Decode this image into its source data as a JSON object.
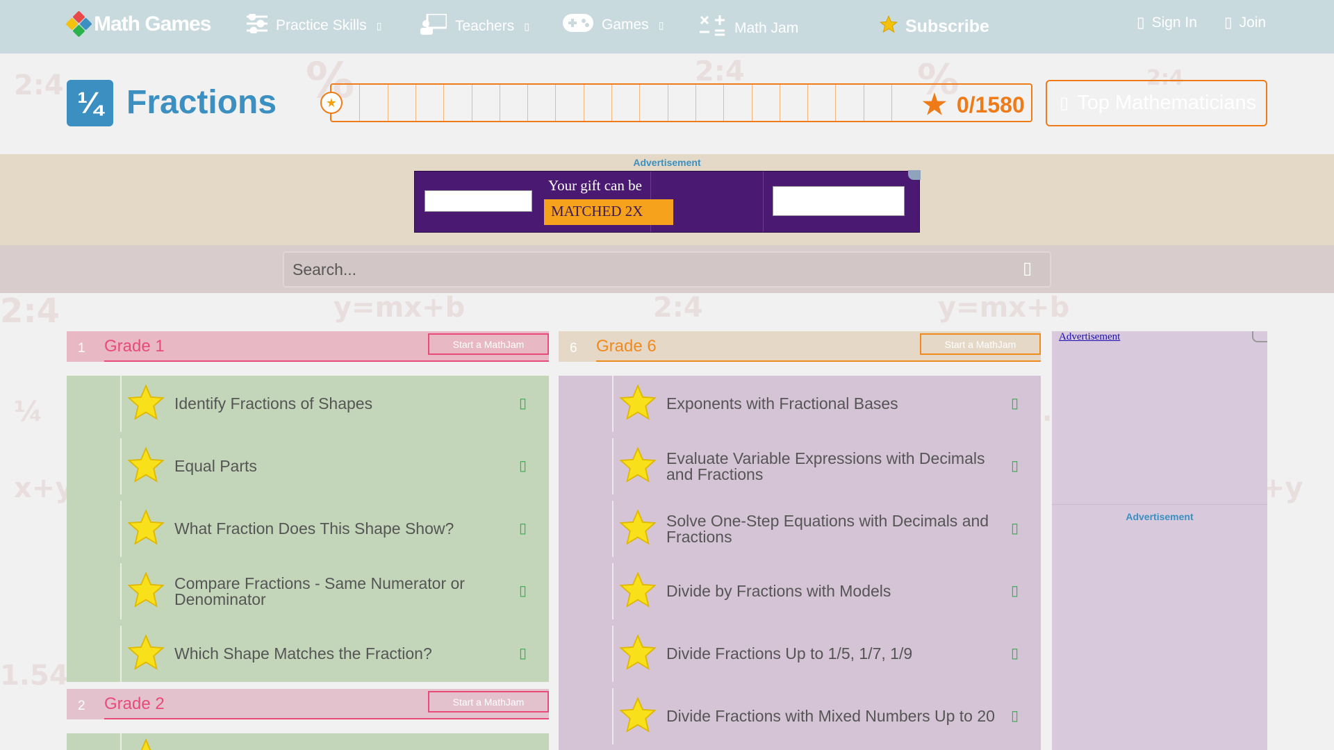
{
  "nav": {
    "logo_text": "Math Games",
    "practice_skills": "Practice Skills",
    "teachers": "Teachers",
    "games": "Games",
    "math_jam": "Math Jam",
    "subscribe": "Subscribe",
    "sign_in": "Sign In",
    "join": "Join"
  },
  "topic": {
    "icon_text": "¼",
    "title": "Fractions",
    "progress_score": "0/1580",
    "top_mathematicians": "Top Mathematicians"
  },
  "ad_top": {
    "label": "Advertisement",
    "line1": "Your gift can be",
    "line2": "MATCHED 2X"
  },
  "search": {
    "placeholder": "Search..."
  },
  "grades": [
    {
      "num": "1",
      "title": "Grade 1",
      "mathjam_label": "Start a MathJam",
      "skills": [
        "Identify Fractions of Shapes",
        "Equal Parts",
        "What Fraction Does This Shape Show?",
        "Compare Fractions - Same Numerator or Denominator",
        "Which Shape Matches the Fraction?"
      ]
    },
    {
      "num": "6",
      "title": "Grade 6",
      "mathjam_label": "Start a MathJam",
      "skills": [
        "Exponents with Fractional Bases",
        "Evaluate Variable Expressions with Decimals and Fractions",
        "Solve One-Step Equations with Decimals and Fractions",
        "Divide by Fractions with Models",
        "Divide Fractions Up to 1/5, 1/7, 1/9",
        "Divide Fractions with Mixed Numbers Up to 20"
      ]
    },
    {
      "num": "2",
      "title": "Grade 2",
      "mathjam_label": "Start a MathJam",
      "skills": []
    }
  ],
  "right_ad": {
    "link_text": "Advertisement",
    "label": "Advertisement"
  },
  "colors": {
    "nav_bg": "#c9dadf",
    "brand_blue": "#3b8fc1",
    "orange": "#ee7b18",
    "grade1_pink": "#e84a7a",
    "grade6_orange": "#f08a1c",
    "check_green": "#2bb24a"
  }
}
